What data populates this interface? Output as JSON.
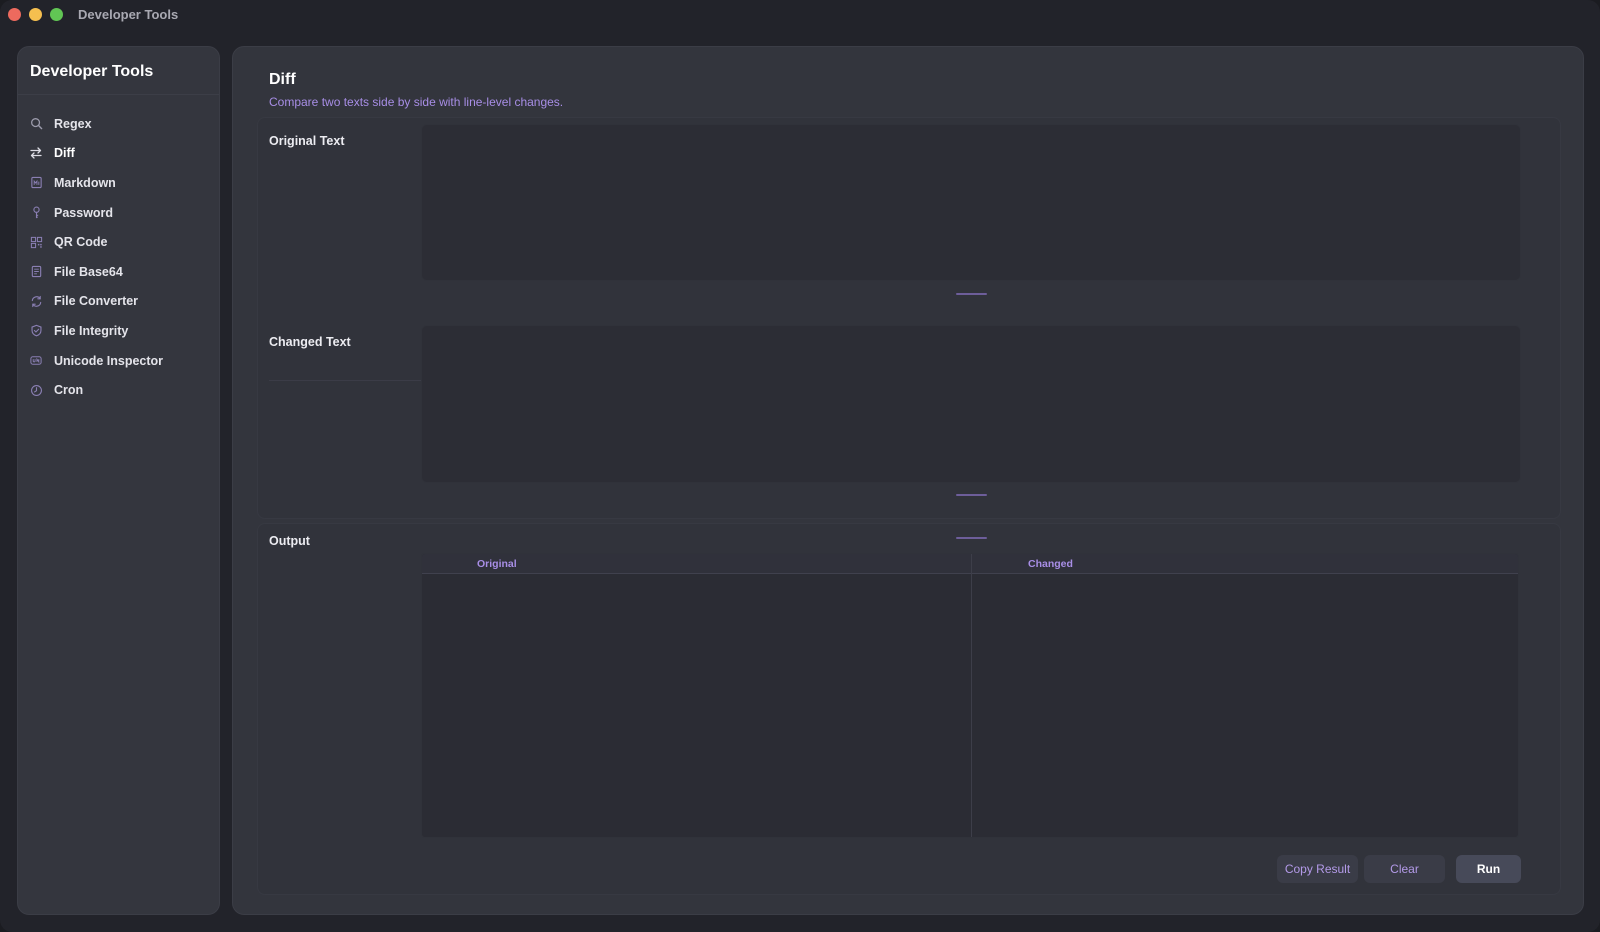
{
  "window": {
    "title": "Developer Tools"
  },
  "sidebar": {
    "title": "Developer Tools",
    "items": [
      {
        "label": "Regex",
        "icon": "search-icon"
      },
      {
        "label": "Diff",
        "icon": "swap-arrows-icon",
        "active": true
      },
      {
        "label": "Markdown",
        "icon": "markdown-doc-icon"
      },
      {
        "label": "Password",
        "icon": "key-icon"
      },
      {
        "label": "QR Code",
        "icon": "qr-code-icon"
      },
      {
        "label": "File Base64",
        "icon": "file-icon"
      },
      {
        "label": "File Converter",
        "icon": "refresh-icon"
      },
      {
        "label": "File Integrity",
        "icon": "shield-check-icon"
      },
      {
        "label": "Unicode Inspector",
        "icon": "unicode-icon"
      },
      {
        "label": "Cron",
        "icon": "clock-icon"
      }
    ]
  },
  "page": {
    "title": "Diff",
    "subtitle": "Compare two texts side by side with line-level changes."
  },
  "inputs": {
    "original_label": "Original Text",
    "original_value": "",
    "changed_label": "Changed Text",
    "changed_value": ""
  },
  "output": {
    "label": "Output",
    "columns": [
      "Original",
      "Changed"
    ]
  },
  "actions": {
    "copy_label": "Copy Result",
    "clear_label": "Clear",
    "run_label": "Run"
  },
  "colors": {
    "accent": "#a88ee6",
    "background": "#22232a",
    "panel": "#33353d"
  }
}
